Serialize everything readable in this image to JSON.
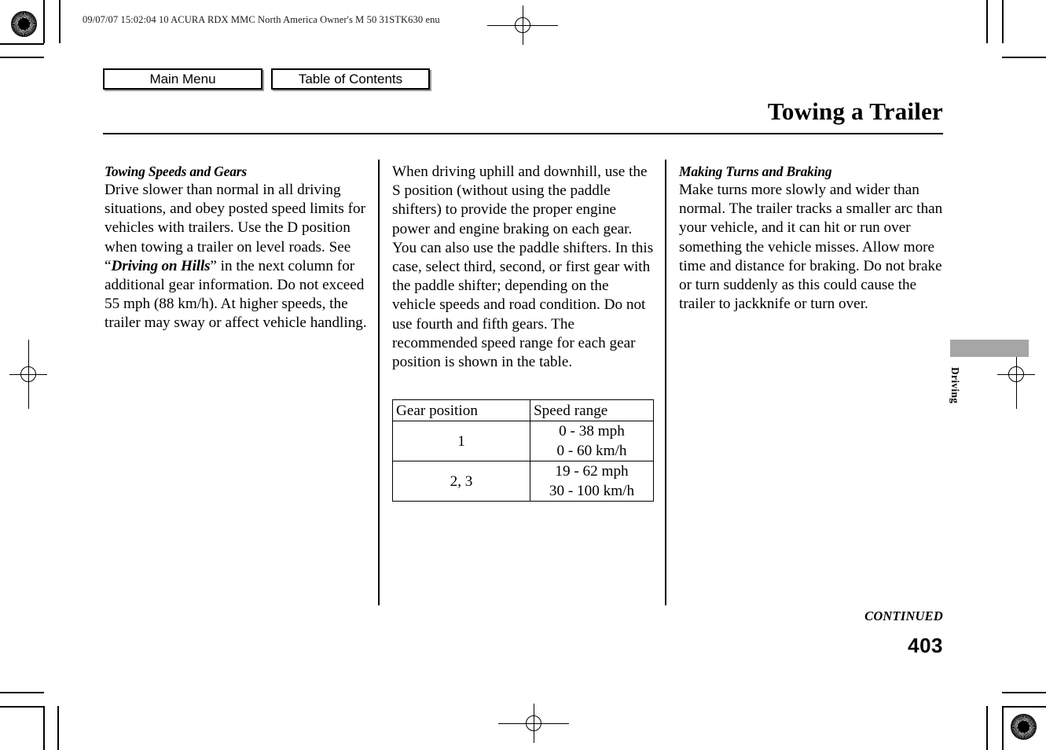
{
  "print_slug": "09/07/07 15:02:04    10 ACURA RDX MMC North America Owner's M 50 31STK630 enu",
  "nav": {
    "main_menu": "Main Menu",
    "table_of_contents": "Table of Contents"
  },
  "page": {
    "title": "Towing a Trailer",
    "continued": "CONTINUED",
    "number": "403",
    "side_tab": "Driving"
  },
  "columns": {
    "left": {
      "heading": "Towing Speeds and Gears",
      "body_part1": "Drive slower than normal in all driving situations, and obey posted speed limits for vehicles with trailers. Use the D position when towing a trailer on level roads. See “",
      "emphasis": "Driving on Hills",
      "body_part2": "” in the next column for additional gear information. Do not exceed 55 mph (88 km/h). At higher speeds, the trailer may sway or affect vehicle handling."
    },
    "middle": {
      "body": "When driving uphill and downhill, use the S position (without using the paddle shifters) to provide the proper engine power and engine braking on each gear. You can also use the paddle shifters. In this case, select third, second, or first gear with the paddle shifter; depending on the vehicle speeds and road condition. Do not use fourth and fifth gears. The recommended speed range for each gear position is shown in the table."
    },
    "right": {
      "heading": "Making Turns and Braking",
      "body": "Make turns more slowly and wider than normal. The trailer tracks a smaller arc than your vehicle, and it can hit or run over something the vehicle misses. Allow more time and distance for braking. Do not brake or turn suddenly as this could cause the trailer to jackknife or turn over."
    }
  },
  "gear_table": {
    "headers": [
      "Gear position",
      "Speed range"
    ],
    "rows": [
      {
        "position": "1",
        "mph": "0 - 38 mph",
        "kmh": "0 - 60 km/h"
      },
      {
        "position": "2, 3",
        "mph": "19 - 62 mph",
        "kmh": "30 - 100 km/h"
      }
    ]
  },
  "colors": {
    "ink": "#000000",
    "paper": "#ffffff",
    "tab_band": "#a6a6a6",
    "button_shadow": "#9a9a9a"
  }
}
